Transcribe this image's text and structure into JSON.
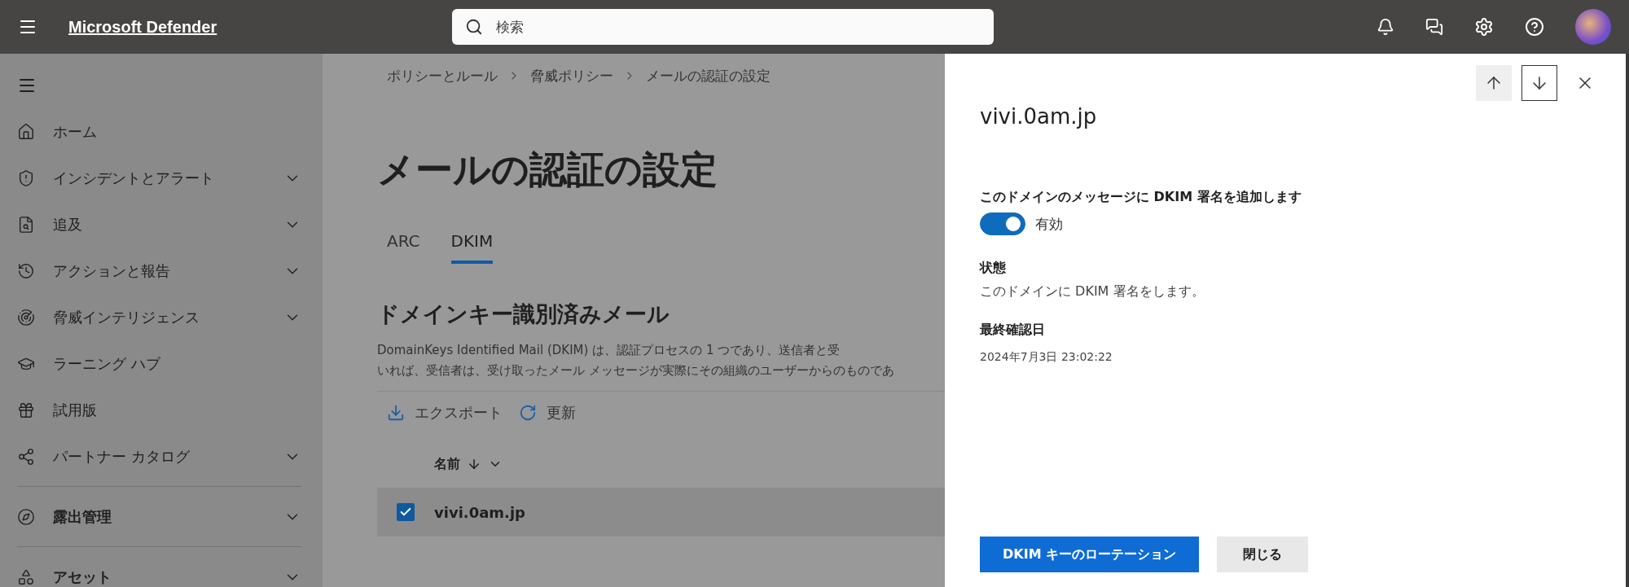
{
  "topbar": {
    "app_name": "Microsoft Defender",
    "search": {
      "placeholder": "検索"
    }
  },
  "sidebar": {
    "items": [
      {
        "label": "ホーム",
        "expandable": false,
        "bold": false
      },
      {
        "label": "インシデントとアラート",
        "expandable": true,
        "bold": false
      },
      {
        "label": "追及",
        "expandable": true,
        "bold": false
      },
      {
        "label": "アクションと報告",
        "expandable": true,
        "bold": false
      },
      {
        "label": "脅威インテリジェンス",
        "expandable": true,
        "bold": false
      },
      {
        "label": "ラーニング ハブ",
        "expandable": false,
        "bold": false
      },
      {
        "label": "試用版",
        "expandable": false,
        "bold": false
      },
      {
        "label": "パートナー カタログ",
        "expandable": true,
        "bold": false
      },
      {
        "label": "露出管理",
        "expandable": true,
        "bold": true
      },
      {
        "label": "アセット",
        "expandable": true,
        "bold": true
      }
    ]
  },
  "main": {
    "breadcrumb": [
      "ポリシーとルール",
      "脅威ポリシー",
      "メールの認証の設定"
    ],
    "title": "メールの認証の設定",
    "tabs": [
      {
        "label": "ARC",
        "selected": false
      },
      {
        "label": "DKIM",
        "selected": true
      }
    ],
    "section_title": "ドメインキー識別済みメール",
    "description": [
      "DomainKeys Identified Mail (DKIM) は、認証プロセスの 1 つであり、送信者と受",
      "いれば、受信者は、受け取ったメール メッセージが実際にその組織のユーザーからのものであ"
    ],
    "toolbar": [
      "エクスポート",
      "更新"
    ],
    "table": {
      "columns": [
        {
          "label": "名前",
          "sorted": true
        }
      ],
      "rows": [
        {
          "name": "vivi.0am.jp",
          "selected": true
        }
      ]
    }
  },
  "panel": {
    "title": "vivi.0am.jp",
    "toggle": {
      "label": "このドメインのメッセージに DKIM 署名を追加します",
      "on": true,
      "state_text": "有効"
    },
    "fields": [
      {
        "label": "状態",
        "value": "このドメインに DKIM 署名をします。",
        "kind": "text"
      },
      {
        "label": "最終確認日",
        "value": "2024年7月3日 23:02:22",
        "kind": "date"
      }
    ],
    "buttons": [
      {
        "label": "DKIM キーのローテーション",
        "kind": "primary"
      },
      {
        "label": "閉じる",
        "kind": "secondary"
      }
    ]
  }
}
